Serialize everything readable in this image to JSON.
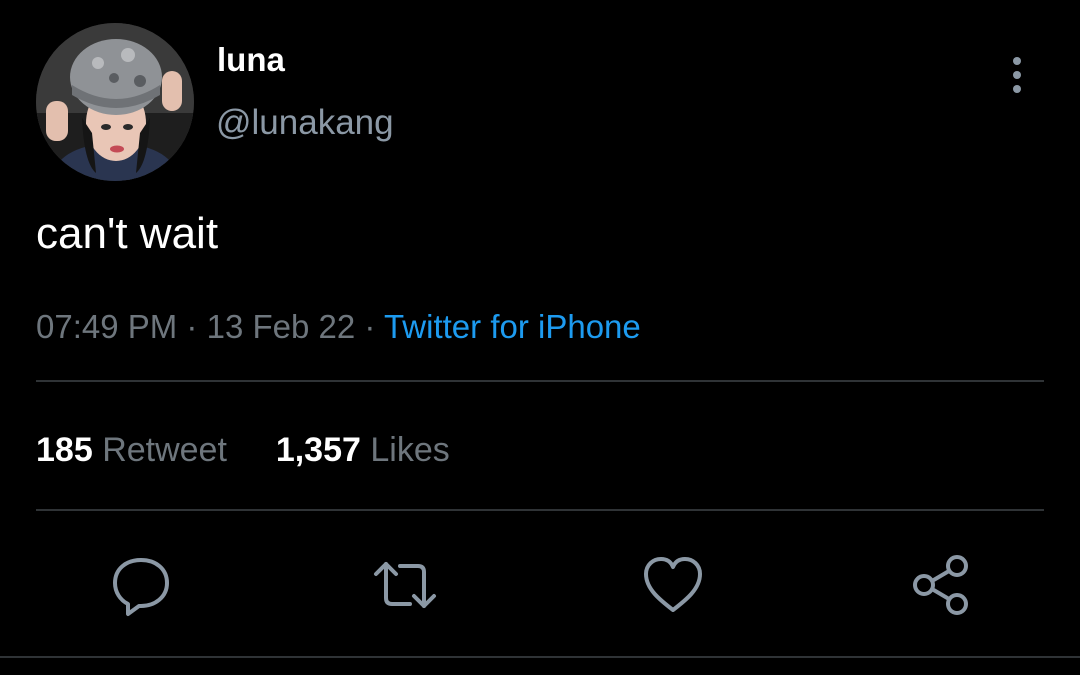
{
  "tweet": {
    "display_name": "luna",
    "handle": "@lunakang",
    "text": "can't wait",
    "time": "07:49 PM",
    "separator": "·",
    "date": "13 Feb 22",
    "source": "Twitter for iPhone"
  },
  "stats": {
    "retweets_count": "185",
    "retweets_label": "Retweet",
    "likes_count": "1,357",
    "likes_label": "Likes"
  },
  "icons": {
    "more": "more-vertical-icon",
    "reply": "reply-icon",
    "retweet": "retweet-icon",
    "like": "heart-icon",
    "share": "share-icon"
  },
  "colors": {
    "background": "#000000",
    "text_primary": "#ffffff",
    "text_secondary": "#6e767d",
    "accent": "#1d9bf0",
    "divider": "#2f3336"
  }
}
